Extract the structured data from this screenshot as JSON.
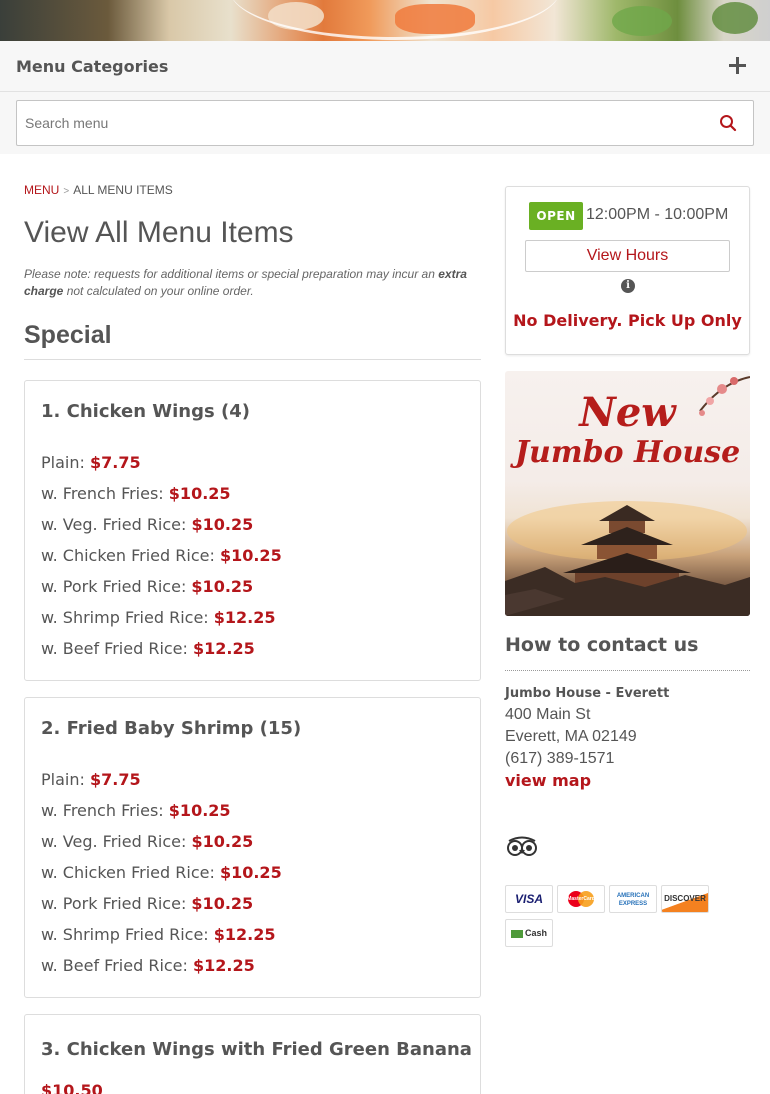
{
  "categories_bar": {
    "title": "Menu Categories"
  },
  "search": {
    "placeholder": "Search menu"
  },
  "breadcrumb": {
    "menu": "MENU",
    "sep": ">",
    "current": "ALL MENU ITEMS"
  },
  "page": {
    "title": "View All Menu Items",
    "note_prefix": "Please note: requests for additional items or special preparation may incur an",
    "note_bold": "extra charge",
    "note_suffix": "not calculated on your online order."
  },
  "section": {
    "title": "Special"
  },
  "items": [
    {
      "name": "1. Chicken Wings (4)",
      "prices": [
        {
          "label": "Plain:",
          "price": "$7.75"
        },
        {
          "label": "w. French Fries:",
          "price": "$10.25"
        },
        {
          "label": "w. Veg. Fried Rice:",
          "price": "$10.25"
        },
        {
          "label": "w. Chicken Fried Rice:",
          "price": "$10.25"
        },
        {
          "label": "w. Pork Fried Rice:",
          "price": "$10.25"
        },
        {
          "label": "w. Shrimp Fried Rice:",
          "price": "$12.25"
        },
        {
          "label": "w. Beef Fried Rice:",
          "price": "$12.25"
        }
      ]
    },
    {
      "name": "2. Fried Baby Shrimp (15)",
      "prices": [
        {
          "label": "Plain:",
          "price": "$7.75"
        },
        {
          "label": "w. French Fries:",
          "price": "$10.25"
        },
        {
          "label": "w. Veg. Fried Rice:",
          "price": "$10.25"
        },
        {
          "label": "w. Chicken Fried Rice:",
          "price": "$10.25"
        },
        {
          "label": "w. Pork Fried Rice:",
          "price": "$10.25"
        },
        {
          "label": "w. Shrimp Fried Rice:",
          "price": "$12.25"
        },
        {
          "label": "w. Beef Fried Rice:",
          "price": "$12.25"
        }
      ]
    },
    {
      "name": "3. Chicken Wings with Fried Green Banana",
      "price": "$10.50"
    }
  ],
  "hours": {
    "status": "OPEN",
    "range": "12:00PM - 10:00PM",
    "view_hours": "View Hours",
    "info_icon": "i",
    "delivery": "No Delivery. Pick Up Only"
  },
  "promo": {
    "line1": "New",
    "line2": "Jumbo House"
  },
  "contact": {
    "title": "How to contact us",
    "business": "Jumbo House - Everett",
    "street": "400 Main St",
    "city": "Everett, MA 02149",
    "phone": "(617) 389-1571",
    "map": "view map"
  },
  "payments": [
    "VISA",
    "MasterCard",
    "AMERICAN EXPRESS",
    "DISCOVER",
    "Cash"
  ],
  "colors": {
    "accent": "#b4161b",
    "open": "#6ab023",
    "text": "#555555"
  }
}
